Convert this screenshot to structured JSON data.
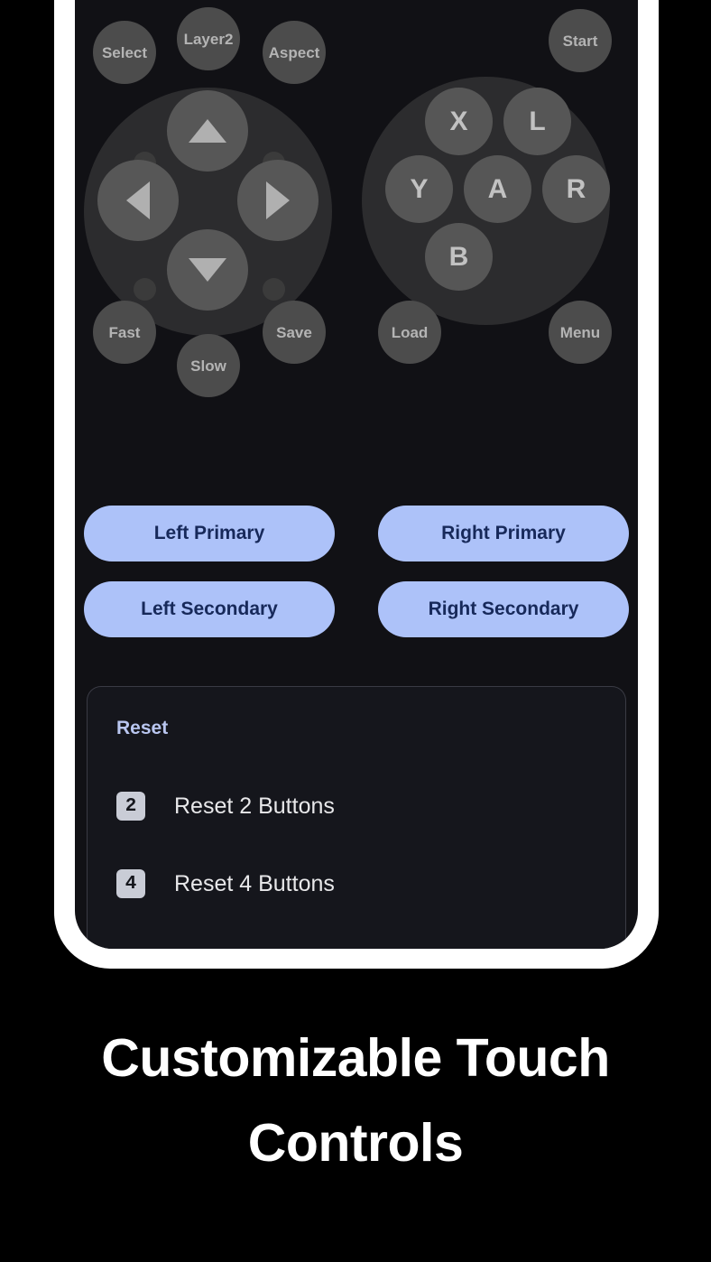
{
  "caption": "Customizable Touch Controls",
  "colors": {
    "screen_bg": "#111115",
    "frame": "#ffffff",
    "accent_blue": "#adc2f9",
    "accent_blue_text": "#17295a",
    "reset_title": "#b9c6f0",
    "pad_button": "#4a4a4a",
    "pad_label": "#b4b4b4"
  },
  "gamepad": {
    "left_cluster": {
      "top_buttons": [
        {
          "label": "Select",
          "name": "pad-button-select"
        },
        {
          "label": "Layer2",
          "name": "pad-button-layer2"
        },
        {
          "label": "Aspect",
          "name": "pad-button-aspect"
        }
      ],
      "dpad": [
        {
          "label": "up",
          "name": "dpad-up-icon"
        },
        {
          "label": "down",
          "name": "dpad-down-icon"
        },
        {
          "label": "left",
          "name": "dpad-left-icon"
        },
        {
          "label": "right",
          "name": "dpad-right-icon"
        }
      ],
      "bottom_buttons": [
        {
          "label": "Fast",
          "name": "pad-button-fast"
        },
        {
          "label": "Slow",
          "name": "pad-button-slow"
        },
        {
          "label": "Save",
          "name": "pad-button-save"
        }
      ]
    },
    "right_cluster": {
      "top_buttons": [
        {
          "label": "Start",
          "name": "pad-button-start"
        }
      ],
      "face_buttons": [
        {
          "label": "X",
          "name": "pad-button-x"
        },
        {
          "label": "L",
          "name": "pad-button-l"
        },
        {
          "label": "Y",
          "name": "pad-button-y"
        },
        {
          "label": "A",
          "name": "pad-button-a"
        },
        {
          "label": "R",
          "name": "pad-button-r"
        },
        {
          "label": "B",
          "name": "pad-button-b"
        }
      ],
      "bottom_buttons": [
        {
          "label": "Load",
          "name": "pad-button-load"
        },
        {
          "label": "Menu",
          "name": "pad-button-menu"
        }
      ]
    }
  },
  "action_buttons": {
    "row1": [
      {
        "label": "Left Primary"
      },
      {
        "label": "Right Primary"
      }
    ],
    "row2": [
      {
        "label": "Left Secondary"
      },
      {
        "label": "Right Secondary"
      }
    ]
  },
  "reset_section": {
    "title": "Reset",
    "items": [
      {
        "badge": "2",
        "label": "Reset 2 Buttons"
      },
      {
        "badge": "4",
        "label": "Reset 4 Buttons"
      }
    ]
  }
}
